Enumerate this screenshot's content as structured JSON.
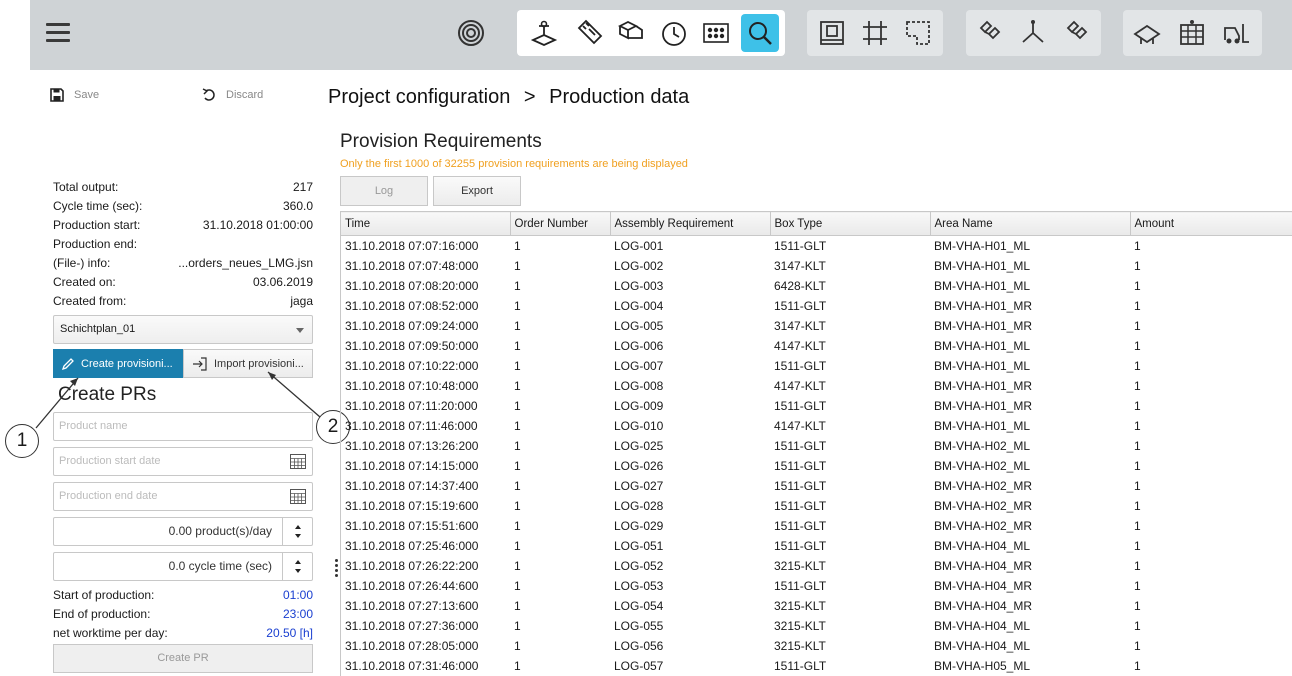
{
  "toolbar": {
    "groups": [
      [
        "target-icon"
      ],
      [
        "box-scale-icon",
        "ruler-icon",
        "boxes-icon",
        "clock-icon",
        "grid-dots-icon",
        "search-gear-icon"
      ],
      [
        "layout-a-icon",
        "grid-icon",
        "layout-b-icon"
      ],
      [
        "link-a-icon",
        "branch-icon",
        "link-b-icon"
      ],
      [
        "truck-tilt-icon",
        "shelf-icon",
        "forklift-icon"
      ]
    ],
    "active_icon": "search-gear-icon",
    "accent_color": "#3ec1e8"
  },
  "actions": {
    "save_label": "Save",
    "discard_label": "Discard"
  },
  "info": [
    {
      "label": "Total output:",
      "value": "217"
    },
    {
      "label": "Cycle time (sec):",
      "value": "360.0"
    },
    {
      "label": "Production start:",
      "value": "31.10.2018 01:00:00"
    },
    {
      "label": "Production end:",
      "value": ""
    },
    {
      "label": "(File-) info:",
      "value": "...orders_neues_LMG.jsn"
    },
    {
      "label": "Created on:",
      "value": "03.06.2019"
    },
    {
      "label": "Created from:",
      "value": "jaga"
    }
  ],
  "plan_select": {
    "value": "Schichtplan_01"
  },
  "buttons": {
    "create_provision": "Create provisioni...",
    "import_provision": "Import provisioni...",
    "create_pr": "Create PR",
    "log": "Log",
    "export": "Export"
  },
  "create_prs": {
    "title": "Create PRs",
    "product_name_placeholder": "Product name",
    "start_date_placeholder": "Production start date",
    "end_date_placeholder": "Production end date",
    "products_per_day": "0.00 product(s)/day",
    "cycle_time": "0.0 cycle time (sec)"
  },
  "times": [
    {
      "label": "Start of production:",
      "value": "01:00"
    },
    {
      "label": "End of production:",
      "value": "23:00"
    },
    {
      "label": "net worktime per day:",
      "value": "20.50 [h]"
    }
  ],
  "callouts": [
    "1",
    "2"
  ],
  "breadcrumb": {
    "parent": "Project configuration",
    "separator": ">",
    "current": "Production data"
  },
  "section_title": "Provision Requirements",
  "warning": "Only the first 1000 of 32255 provision requirements are being displayed",
  "warning_color": "#f0a020",
  "table": {
    "columns": [
      "Time",
      "Order Number",
      "Assembly Requirement",
      "Box Type",
      "Area Name",
      "Amount"
    ],
    "rows": [
      [
        "31.10.2018 07:07:16:000",
        "1",
        "LOG-001",
        "1511-GLT",
        "BM-VHA-H01_ML",
        "1"
      ],
      [
        "31.10.2018 07:07:48:000",
        "1",
        "LOG-002",
        "3147-KLT",
        "BM-VHA-H01_ML",
        "1"
      ],
      [
        "31.10.2018 07:08:20:000",
        "1",
        "LOG-003",
        "6428-KLT",
        "BM-VHA-H01_ML",
        "1"
      ],
      [
        "31.10.2018 07:08:52:000",
        "1",
        "LOG-004",
        "1511-GLT",
        "BM-VHA-H01_MR",
        "1"
      ],
      [
        "31.10.2018 07:09:24:000",
        "1",
        "LOG-005",
        "3147-KLT",
        "BM-VHA-H01_MR",
        "1"
      ],
      [
        "31.10.2018 07:09:50:000",
        "1",
        "LOG-006",
        "4147-KLT",
        "BM-VHA-H01_ML",
        "1"
      ],
      [
        "31.10.2018 07:10:22:000",
        "1",
        "LOG-007",
        "1511-GLT",
        "BM-VHA-H01_ML",
        "1"
      ],
      [
        "31.10.2018 07:10:48:000",
        "1",
        "LOG-008",
        "4147-KLT",
        "BM-VHA-H01_MR",
        "1"
      ],
      [
        "31.10.2018 07:11:20:000",
        "1",
        "LOG-009",
        "1511-GLT",
        "BM-VHA-H01_MR",
        "1"
      ],
      [
        "31.10.2018 07:11:46:000",
        "1",
        "LOG-010",
        "4147-KLT",
        "BM-VHA-H01_ML",
        "1"
      ],
      [
        "31.10.2018 07:13:26:200",
        "1",
        "LOG-025",
        "1511-GLT",
        "BM-VHA-H02_ML",
        "1"
      ],
      [
        "31.10.2018 07:14:15:000",
        "1",
        "LOG-026",
        "1511-GLT",
        "BM-VHA-H02_ML",
        "1"
      ],
      [
        "31.10.2018 07:14:37:400",
        "1",
        "LOG-027",
        "1511-GLT",
        "BM-VHA-H02_MR",
        "1"
      ],
      [
        "31.10.2018 07:15:19:600",
        "1",
        "LOG-028",
        "1511-GLT",
        "BM-VHA-H02_MR",
        "1"
      ],
      [
        "31.10.2018 07:15:51:600",
        "1",
        "LOG-029",
        "1511-GLT",
        "BM-VHA-H02_MR",
        "1"
      ],
      [
        "31.10.2018 07:25:46:000",
        "1",
        "LOG-051",
        "1511-GLT",
        "BM-VHA-H04_ML",
        "1"
      ],
      [
        "31.10.2018 07:26:22:200",
        "1",
        "LOG-052",
        "3215-KLT",
        "BM-VHA-H04_MR",
        "1"
      ],
      [
        "31.10.2018 07:26:44:600",
        "1",
        "LOG-053",
        "1511-GLT",
        "BM-VHA-H04_MR",
        "1"
      ],
      [
        "31.10.2018 07:27:13:600",
        "1",
        "LOG-054",
        "3215-KLT",
        "BM-VHA-H04_MR",
        "1"
      ],
      [
        "31.10.2018 07:27:36:000",
        "1",
        "LOG-055",
        "3215-KLT",
        "BM-VHA-H04_ML",
        "1"
      ],
      [
        "31.10.2018 07:28:05:000",
        "1",
        "LOG-056",
        "3215-KLT",
        "BM-VHA-H04_ML",
        "1"
      ],
      [
        "31.10.2018 07:31:46:000",
        "1",
        "LOG-057",
        "1511-GLT",
        "BM-VHA-H05_ML",
        "1"
      ]
    ]
  }
}
